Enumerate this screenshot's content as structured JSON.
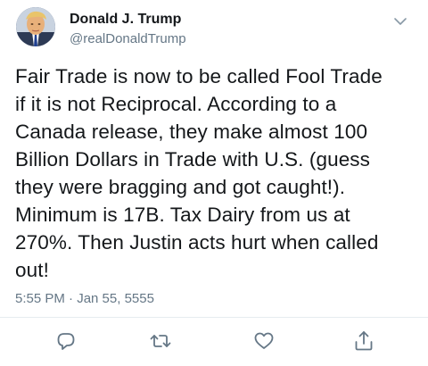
{
  "tweet": {
    "author": {
      "name": "Donald J. Trump",
      "handle": "@realDonaldTrump"
    },
    "text": "Fair Trade is now to be called Fool Trade\nif it is not Reciprocal. According to a\nCanada release, they make almost 100\nBillion Dollars in Trade with U.S. (guess\nthey were bragging and got caught!).\nMinimum is 17B. Tax Dairy from us at\n270%. Then Justin acts hurt when called\nout!",
    "timestamp": "5:55 PM · Jan 55, 5555"
  },
  "icons": {
    "menu": "chevron-down-icon",
    "reply": "reply-icon",
    "retweet": "retweet-icon",
    "like": "heart-icon",
    "share": "share-icon"
  },
  "colors": {
    "text": "#14171a",
    "secondary": "#657786",
    "divider": "#e6ecf0",
    "icon": "#657786"
  }
}
